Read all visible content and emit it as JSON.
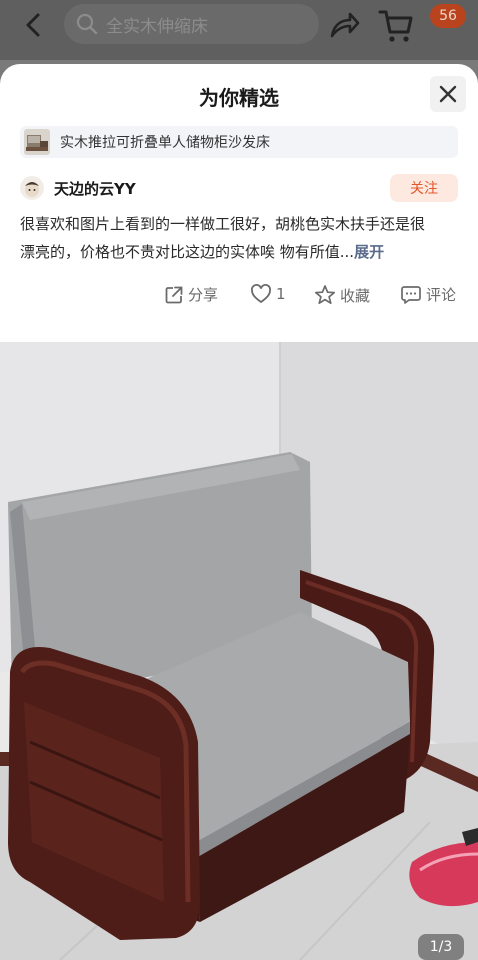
{
  "topbar": {
    "search_text": "全实木伸缩床",
    "cart_badge": "56"
  },
  "sheet": {
    "title": "为你精选",
    "product_name": "实木推拉可折叠单人储物柜沙发床",
    "user": {
      "name": "天边的云YY",
      "follow_label": "关注"
    },
    "review": {
      "line1": "很喜欢和图片上看到的一样做工很好，胡桃色实木扶手还是很",
      "line2": "漂亮的，价格也不贵对比这边的实体唉 物有所值...",
      "more": "展开"
    },
    "actions": {
      "share": "分享",
      "like_count": "1",
      "favorite": "收藏",
      "comment": "评论"
    }
  },
  "photo": {
    "pager": "1/3"
  },
  "colors": {
    "accent_orange": "#e2562a",
    "follow_bg": "#fde9df",
    "badge_bg": "#b8431d",
    "link_blue": "#5b6b8c"
  }
}
